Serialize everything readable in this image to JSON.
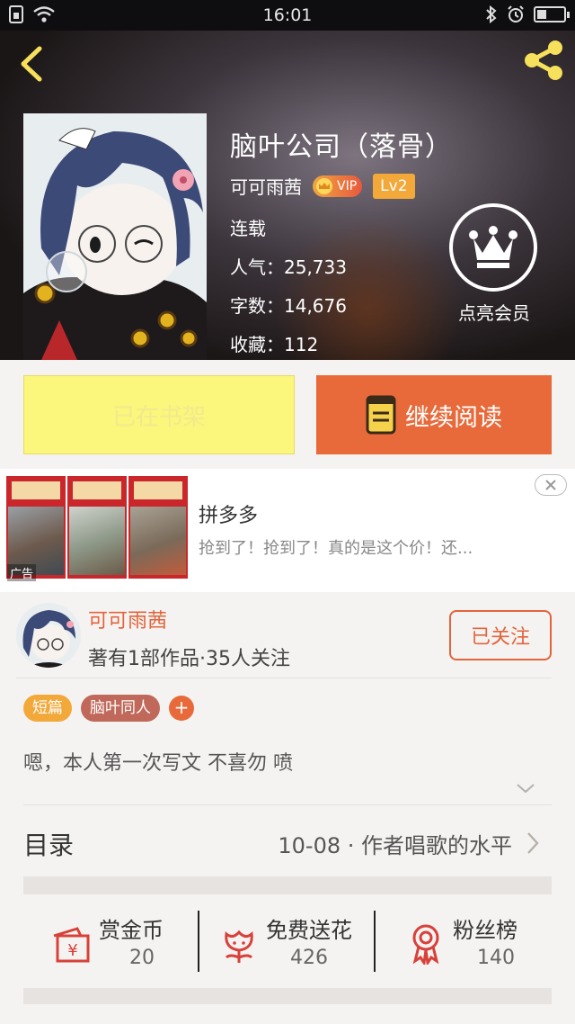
{
  "status_bar": {
    "time": "16:01"
  },
  "book": {
    "title": "脑叶公司（落骨）",
    "author": "可可雨茜",
    "vip_label": "VIP",
    "level": "Lv2",
    "status": "连载",
    "popularity": "人气：25,733",
    "word_count": "字数：14,676",
    "favorites": "收藏：112",
    "member_label": "点亮会员"
  },
  "actions": {
    "shelf_label": "已在书架",
    "read_label": "继续阅读"
  },
  "ad": {
    "title": "拼多多",
    "description": "抢到了！抢到了！真的是这个价！还...",
    "tag": "广告"
  },
  "author_card": {
    "name": "可可雨茜",
    "stats": "著有1部作品·35人关注",
    "follow_label": "已关注"
  },
  "tags": [
    {
      "label": "短篇",
      "color": "#f3a83a"
    },
    {
      "label": "脑叶同人",
      "color": "#c0685a"
    }
  ],
  "tag_add": "+",
  "description": "嗯，本人第一次写文 不喜勿 喷",
  "toc": {
    "label": "目录",
    "latest": "10-08 · 作者唱歌的水平"
  },
  "stats": [
    {
      "label": "赏金币",
      "value": "20"
    },
    {
      "label": "免费送花",
      "value": "426"
    },
    {
      "label": "粉丝榜",
      "value": "140"
    }
  ],
  "colors": {
    "accent": "#e86a3a",
    "shelf_button": "#fbf67c",
    "author_name": "#e2643c"
  }
}
